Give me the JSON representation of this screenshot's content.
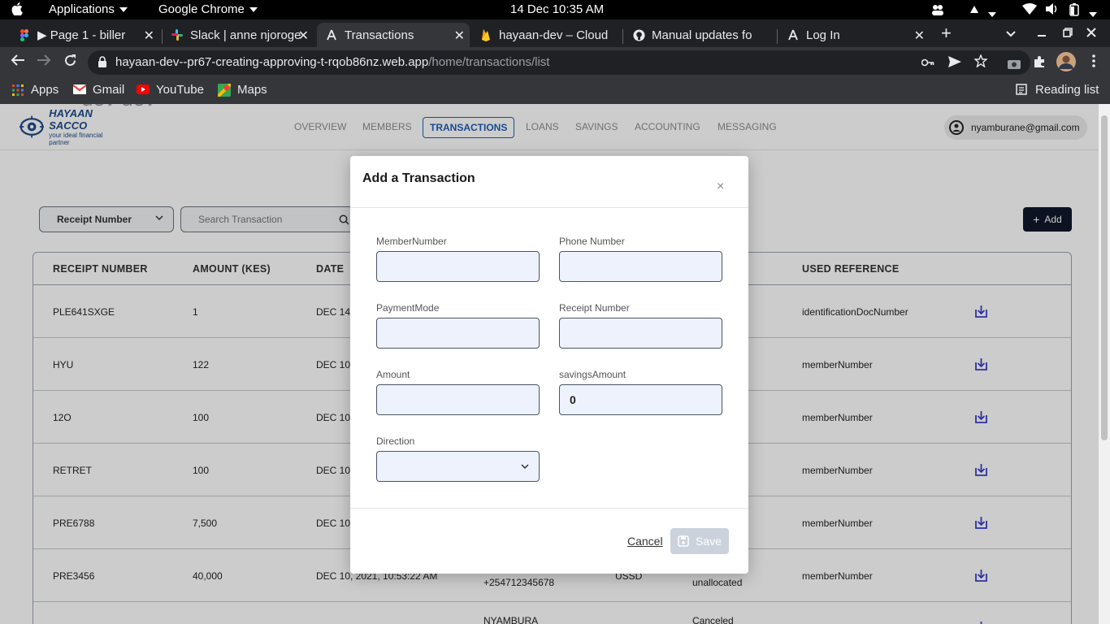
{
  "os": {
    "applications": "Applications",
    "active_app": "Google Chrome",
    "datetime": "14 Dec  10:35 AM"
  },
  "tabs": [
    {
      "label": "▶ Page 1 - biller"
    },
    {
      "label": "Slack | anne njoroge"
    },
    {
      "label": "Transactions"
    },
    {
      "label": "hayaan-dev – Cloud"
    },
    {
      "label": "Manual updates fo"
    },
    {
      "label": "Log In"
    }
  ],
  "address": {
    "host": "hayaan-dev--pr67-creating-approving-t-rqob86nz.web.app",
    "path": "/home/transactions/list"
  },
  "bookmarks": {
    "apps": "Apps",
    "gmail": "Gmail",
    "youtube": "YouTube",
    "maps": "Maps",
    "reading_list": "Reading list"
  },
  "watermark": "dev dev",
  "logo": {
    "title": "HAYAAN SACCO",
    "tagline": "your ideal financial partner"
  },
  "nav": {
    "overview": "OVERVIEW",
    "members": "MEMBERS",
    "transactions": "TRANSACTIONS",
    "loans": "LOANS",
    "savings": "SAVINGS",
    "accounting": "ACCOUNTING",
    "messaging": "MESSAGING"
  },
  "user": {
    "email": "nyamburane@gmail.com"
  },
  "toolbar": {
    "filter_value": "Receipt Number",
    "search_placeholder": "Search Transaction",
    "add_label": "Add"
  },
  "table": {
    "headers": {
      "receipt": "RECEIPT NUMBER",
      "amount": "AMOUNT (KES)",
      "date": "DATE",
      "used_reference": "USED REFERENCE"
    },
    "rows": [
      {
        "receipt": "PLE641SXGE",
        "amount": "1",
        "date": "DEC 14",
        "phone": "",
        "mode": "",
        "status": "",
        "ref": "identificationDocNumber"
      },
      {
        "receipt": "HYU",
        "amount": "122",
        "date": "DEC 10",
        "phone": "",
        "mode": "",
        "status": "",
        "ref": "memberNumber"
      },
      {
        "receipt": "12O",
        "amount": "100",
        "date": "DEC 10",
        "phone": "",
        "mode": "",
        "status": "",
        "ref": "memberNumber"
      },
      {
        "receipt": "RETRET",
        "amount": "100",
        "date": "DEC 10",
        "phone": "",
        "mode": "",
        "status": "",
        "ref": "memberNumber"
      },
      {
        "receipt": "PRE6788",
        "amount": "7,500",
        "date": "DEC 10",
        "phone": "",
        "mode": "",
        "status": "",
        "ref": "memberNumber"
      },
      {
        "receipt": "PRE3456",
        "amount": "40,000",
        "date": "DEC 10, 2021, 10:53:22 AM",
        "phone": "+254712345678",
        "mode": "USSD",
        "status": "unallocated",
        "ref": "memberNumber"
      },
      {
        "receipt": "",
        "amount": "",
        "date": "",
        "phone": "NYAMBURA",
        "mode": "",
        "status": "Canceled",
        "ref": ""
      }
    ]
  },
  "modal": {
    "title": "Add a Transaction",
    "close": "×",
    "fields": {
      "member_number": {
        "label": "MemberNumber",
        "value": ""
      },
      "phone_number": {
        "label": "Phone Number",
        "value": ""
      },
      "payment_mode": {
        "label": "PaymentMode",
        "value": ""
      },
      "receipt_number": {
        "label": "Receipt Number",
        "value": ""
      },
      "amount": {
        "label": "Amount",
        "value": ""
      },
      "savings_amount": {
        "label": "savingsAmount",
        "value": "0"
      },
      "direction": {
        "label": "Direction",
        "value": ""
      }
    },
    "cancel": "Cancel",
    "save": "Save"
  }
}
